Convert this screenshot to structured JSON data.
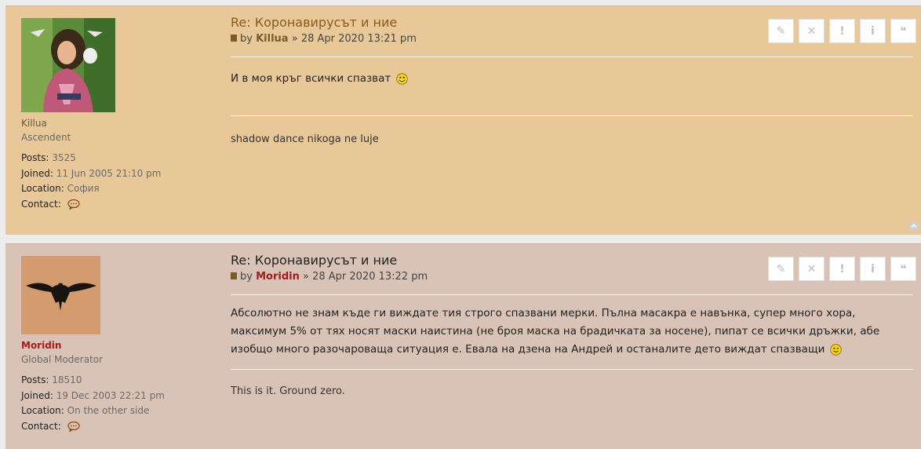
{
  "posts": [
    {
      "title": "Re: Коронавирусът и ние",
      "by": "by",
      "author": "Killua",
      "date_sep": "»",
      "date": "28 Apr 2020 13:21 pm",
      "content": "И в моя кръг всички спазват",
      "signature": "shadow dance nikoga ne luje",
      "profile": {
        "username": "Killua",
        "rank": "Ascendent",
        "posts_label": "Posts:",
        "posts": "3525",
        "joined_label": "Joined:",
        "joined": "11 Jun 2005 21:10 pm",
        "location_label": "Location:",
        "location": "София",
        "contact_label": "Contact:"
      }
    },
    {
      "title": "Re: Коронавирусът и ние",
      "by": "by",
      "author": "Moridin",
      "date_sep": "»",
      "date": "28 Apr 2020 13:22 pm",
      "content": "Абсолютно не знам къде ги виждате тия строго спазвани мерки. Пълна масакра е навънка, супер много хора, максимум 5% от тях носят маски наистина (не броя маска на брадичката за носене), пипат се всички дръжки, абе изобщо много разочароваща ситуация е. Евала на дзена на Андрей и останалите дето виждат спазващи",
      "signature": "This is it. Ground zero.",
      "profile": {
        "username": "Moridin",
        "rank": "Global Moderator",
        "posts_label": "Posts:",
        "posts": "18510",
        "joined_label": "Joined:",
        "joined": "19 Dec 2003 22:21 pm",
        "location_label": "Location:",
        "location": "On the other side",
        "contact_label": "Contact:"
      }
    }
  ],
  "buttons": [
    {
      "name": "edit-button",
      "icon": "pencil-icon",
      "glyph": "✎"
    },
    {
      "name": "delete-button",
      "icon": "close-icon",
      "glyph": "✕"
    },
    {
      "name": "report-button",
      "icon": "exclamation-icon",
      "glyph": "!"
    },
    {
      "name": "info-button",
      "icon": "info-icon",
      "glyph": "i"
    },
    {
      "name": "quote-button",
      "icon": "quote-icon",
      "glyph": "❝"
    }
  ],
  "colors": {
    "post1_bg": "#e8c898",
    "post2_bg": "#d9c2b6",
    "moderator_red": "#a51c1c"
  }
}
